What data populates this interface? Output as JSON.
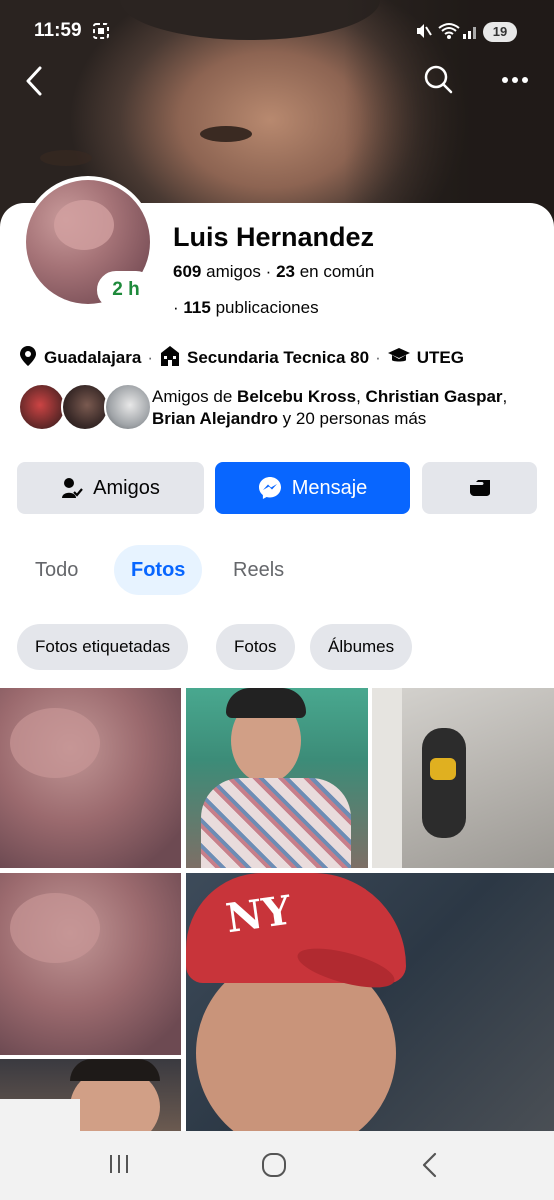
{
  "status_bar": {
    "time": "11:59",
    "battery": "19",
    "icons": [
      "screenshot-icon",
      "mute-icon",
      "wifi-icon",
      "signal-icon"
    ]
  },
  "header": {
    "back_icon": "back-arrow-icon",
    "search_icon": "search-icon",
    "more_icon": "more-options-icon"
  },
  "profile": {
    "name": "Luis Hernandez",
    "active_status": "2 h",
    "friends_count": "609",
    "friends_label": "amigos",
    "mutual_sep": "·",
    "mutual_count": "23",
    "mutual_label": "en común",
    "posts_prefix": "·",
    "posts_count": "115",
    "posts_label": "publicaciones"
  },
  "info": {
    "location": "Guadalajara",
    "school": "Secundaria Tecnica 80",
    "college": "UTEG",
    "separator": "·"
  },
  "mutual_friends": {
    "prefix": "Amigos de ",
    "names": [
      "Belcebu Kross",
      "Christian Gaspar",
      "Brian Alejandro"
    ],
    "sep1": ", ",
    "sep2": ",",
    "and_text": " y 20 personas más"
  },
  "actions": {
    "friends_label": "Amigos",
    "message_label": "Mensaje",
    "accent_color": "#0866ff"
  },
  "tabs": [
    {
      "label": "Todo",
      "active": false
    },
    {
      "label": "Fotos",
      "active": true
    },
    {
      "label": "Reels",
      "active": false
    }
  ],
  "photo_filters": [
    "Fotos etiquetadas",
    "Fotos",
    "Álbumes"
  ],
  "photos_count_visible": 6
}
